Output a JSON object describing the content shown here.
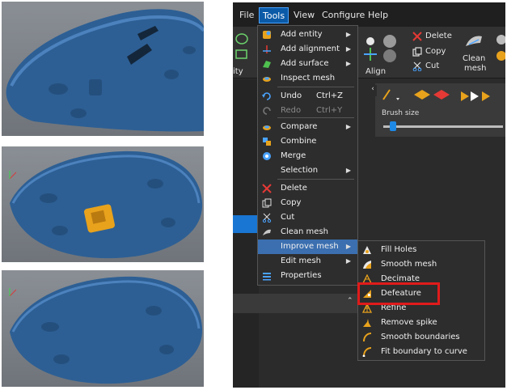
{
  "menubar": {
    "items": [
      "File",
      "Tools",
      "View",
      "Configure",
      "Help"
    ],
    "active": "Tools"
  },
  "ribbon": {
    "delete": "Delete",
    "copy": "Copy",
    "cut": "Cut",
    "clean_mesh_line1": "Clean",
    "clean_mesh_line2": "mesh",
    "align": "Align",
    "left_fragment": "ity"
  },
  "tools_menu": {
    "items": [
      {
        "label": "Add entity",
        "submenu": true,
        "icon": "add-entity-icon"
      },
      {
        "label": "Add alignment",
        "submenu": true,
        "icon": "add-alignment-icon"
      },
      {
        "label": "Add surface",
        "submenu": true,
        "icon": "add-surface-icon"
      },
      {
        "label": "Inspect mesh",
        "submenu": false,
        "icon": "inspect-mesh-icon"
      },
      {
        "label": "Undo",
        "shortcut": "Ctrl+Z",
        "icon": "undo-icon"
      },
      {
        "label": "Redo",
        "shortcut": "Ctrl+Y",
        "icon": "redo-icon",
        "disabled": true
      },
      {
        "label": "Compare",
        "submenu": true,
        "icon": "compare-icon"
      },
      {
        "label": "Combine",
        "submenu": false,
        "icon": "combine-icon"
      },
      {
        "label": "Merge",
        "submenu": false,
        "icon": "merge-icon"
      },
      {
        "label": "Selection",
        "submenu": true,
        "icon": ""
      },
      {
        "label": "Delete",
        "submenu": false,
        "icon": "delete-icon"
      },
      {
        "label": "Copy",
        "submenu": false,
        "icon": "copy-icon"
      },
      {
        "label": "Cut",
        "submenu": false,
        "icon": "cut-icon"
      },
      {
        "label": "Clean mesh",
        "submenu": false,
        "icon": "clean-mesh-icon"
      },
      {
        "label": "Improve mesh",
        "submenu": true,
        "icon": "",
        "highlighted": true
      },
      {
        "label": "Edit mesh",
        "submenu": true,
        "icon": ""
      },
      {
        "label": "Properties",
        "submenu": false,
        "icon": "properties-icon"
      }
    ]
  },
  "improve_menu": {
    "items": [
      {
        "label": "Fill Holes",
        "icon": "fill-holes-icon"
      },
      {
        "label": "Smooth mesh",
        "icon": "smooth-mesh-icon"
      },
      {
        "label": "Decimate",
        "icon": "decimate-icon"
      },
      {
        "label": "Defeature",
        "icon": "defeature-icon",
        "boxed": true
      },
      {
        "label": "Refine",
        "icon": "refine-icon"
      },
      {
        "label": "Remove spike",
        "icon": "remove-spike-icon"
      },
      {
        "label": "Smooth boundaries",
        "icon": "smooth-boundaries-icon"
      },
      {
        "label": "Fit boundary to curve",
        "icon": "fit-boundary-icon"
      }
    ]
  },
  "brush_panel": {
    "label": "Brush size",
    "level_fraction": 0.08
  },
  "colors": {
    "mesh_blue": "#2d5f94",
    "defeature_patch": "#e8a21c",
    "highlight": "#3b6fb0",
    "callout_red": "#e01b1b"
  }
}
